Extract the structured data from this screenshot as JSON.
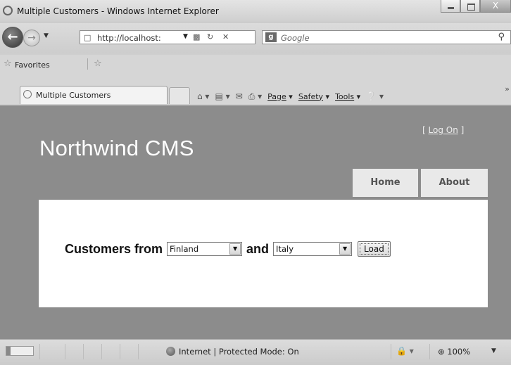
{
  "window": {
    "title": "Multiple Customers - Windows Internet Explorer",
    "close_label": "X"
  },
  "address": {
    "url": "http://localhost:",
    "search_placeholder": "Google"
  },
  "favorites": {
    "label": "Favorites"
  },
  "tab": {
    "label": "Multiple Customers"
  },
  "command_bar": {
    "page": "Page",
    "safety": "Safety",
    "tools": "Tools"
  },
  "site": {
    "logon_prefix": "[ ",
    "logon_link": "Log On",
    "logon_suffix": " ]",
    "brand": "Northwind CMS",
    "menu": {
      "home": "Home",
      "about": "About"
    }
  },
  "form": {
    "label_from": "Customers from",
    "country1": "Finland",
    "label_and": "and",
    "country2": "Italy",
    "load_button": "Load"
  },
  "status": {
    "zone": "Internet | Protected Mode: On",
    "zoom": "100%"
  }
}
